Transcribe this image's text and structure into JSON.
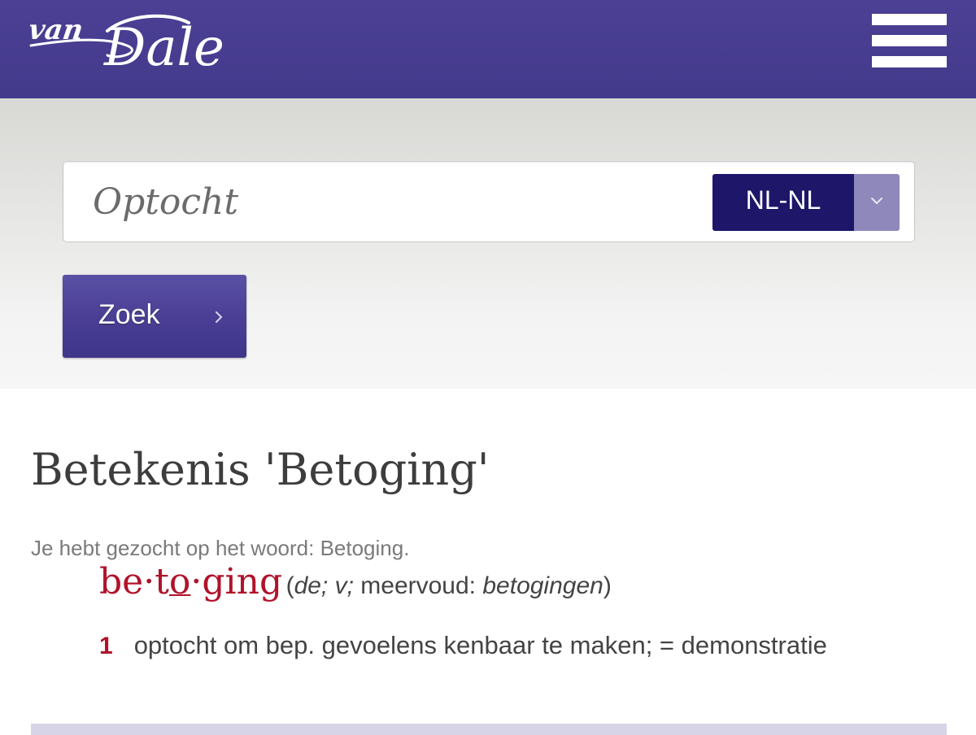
{
  "header": {
    "logo_text": "van Dale",
    "menu_icon": "hamburger-menu-icon"
  },
  "search": {
    "query": "Optocht",
    "language": "NL-NL",
    "language_arrow_icon": "chevron-down-icon",
    "submit_label": "Zoek",
    "submit_icon": "chevron-right-icon"
  },
  "result": {
    "title": "Betekenis 'Betoging'",
    "searched_for": "Je hebt gezocht op het woord: Betoging.",
    "headword_parts": [
      "be·t",
      "o",
      "·ging"
    ],
    "grammar": {
      "open": "(",
      "article": "de; v;",
      "plural_label": " meervoud: ",
      "plural": "betogingen",
      "close": ")"
    },
    "senses": [
      {
        "number": "1",
        "text": "optocht om bep. gevoelens kenbaar te maken; = demonstratie"
      }
    ]
  },
  "colors": {
    "brand_purple": "#4b4094",
    "select_navy": "#1d1669",
    "headword_red": "#b0132a"
  }
}
